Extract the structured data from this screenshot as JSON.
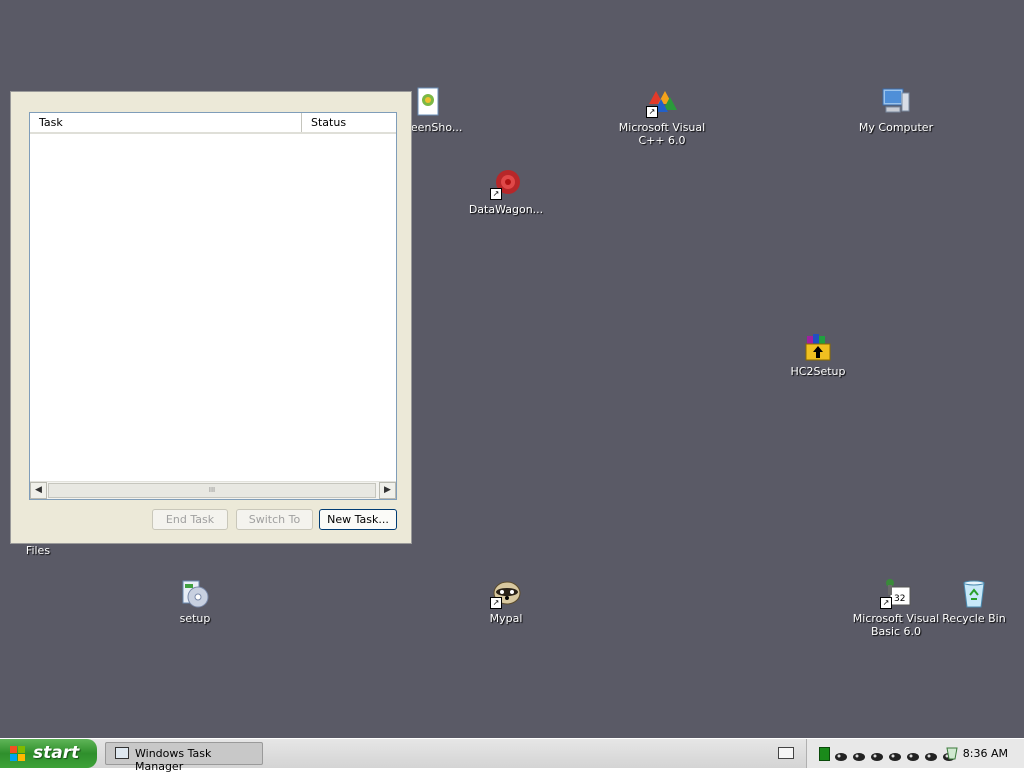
{
  "desktop": {
    "icons": [
      {
        "id": "screenshot",
        "label": "ScreenSho..."
      },
      {
        "id": "vcpp",
        "label": "Microsoft Visual C++ 6.0"
      },
      {
        "id": "mycomputer",
        "label": "My Computer"
      },
      {
        "id": "datawagon",
        "label": "DataWagon..."
      },
      {
        "id": "hc2setup",
        "label": "HC2Setup"
      },
      {
        "id": "files",
        "label": "Files"
      },
      {
        "id": "setup",
        "label": "setup"
      },
      {
        "id": "mypal",
        "label": "Mypal"
      },
      {
        "id": "vb6",
        "label": "Microsoft Visual Basic 6.0"
      },
      {
        "id": "recycle",
        "label": "Recycle Bin"
      }
    ]
  },
  "task_manager": {
    "columns": [
      "Task",
      "Status"
    ],
    "rows": [],
    "scroll_thumb_grip": "III",
    "buttons": {
      "end_task": "End Task",
      "switch_to": "Switch To",
      "new_task": "New Task..."
    }
  },
  "taskbar": {
    "start_label": "start",
    "tasks": [
      {
        "label": "Windows Task Manager"
      }
    ],
    "clock": "8:36 AM"
  },
  "colors": {
    "desktop_bg": "#5a5a66",
    "start_green": "#3da238",
    "window_bg": "#ece9d8"
  }
}
